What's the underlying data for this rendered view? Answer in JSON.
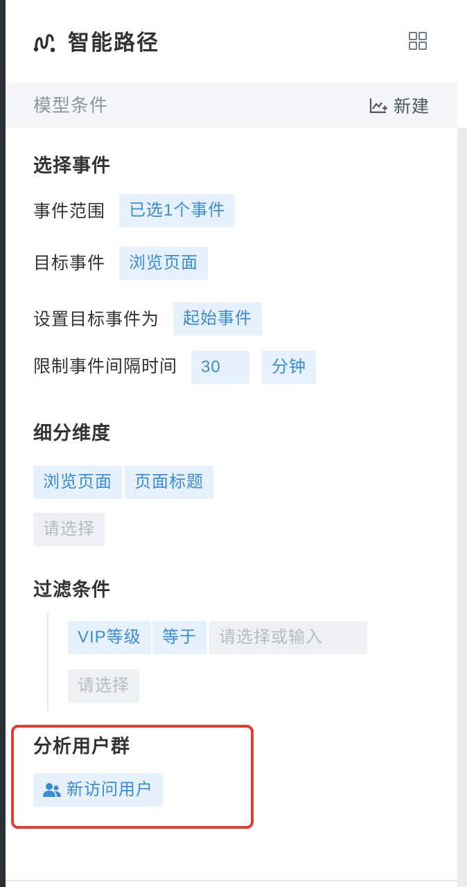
{
  "header": {
    "title": "智能路径",
    "logo_icon": "path-logo-icon",
    "grid_icon": "grid-icon"
  },
  "model_bar": {
    "title": "模型条件",
    "new_label": "新建",
    "new_icon": "add-chart-icon"
  },
  "select_event": {
    "heading": "选择事件",
    "range_label": "事件范围",
    "range_value": "已选1个事件",
    "target_label": "目标事件",
    "target_value": "浏览页面",
    "set_target_label": "设置目标事件为",
    "set_target_value": "起始事件",
    "interval_label": "限制事件间隔时间",
    "interval_value": "30",
    "interval_unit": "分钟"
  },
  "dimension": {
    "heading": "细分维度",
    "tags": [
      "浏览页面",
      "页面标题"
    ],
    "placeholder": "请选择"
  },
  "filter": {
    "heading": "过滤条件",
    "field": "VIP等级",
    "operator": "等于",
    "value_placeholder": "请选择或输入",
    "add_placeholder": "请选择"
  },
  "user_group": {
    "heading": "分析用户群",
    "value": "新访问用户",
    "icon": "users-icon"
  },
  "colors": {
    "accent": "#3a8bd6",
    "tag_bg": "#e6f1fb",
    "highlight": "#e53a2f",
    "section_bar_bg": "#f3f5f7"
  }
}
